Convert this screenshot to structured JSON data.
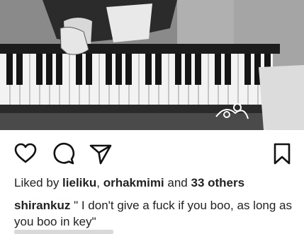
{
  "post": {
    "image_alt": "",
    "actions": {
      "like_icon": "heart-icon",
      "comment_icon": "comment-icon",
      "share_icon": "send-icon",
      "save_icon": "bookmark-icon"
    },
    "likes": {
      "prefix": "Liked by ",
      "user1": "lieliku",
      "separator": ", ",
      "user2": "orhakmimi",
      "middle": " and ",
      "others": "33 others"
    },
    "caption": {
      "username": "shirankuz",
      "text": " \" I don't give a fuck if you boo, as long as you boo in key\""
    }
  }
}
